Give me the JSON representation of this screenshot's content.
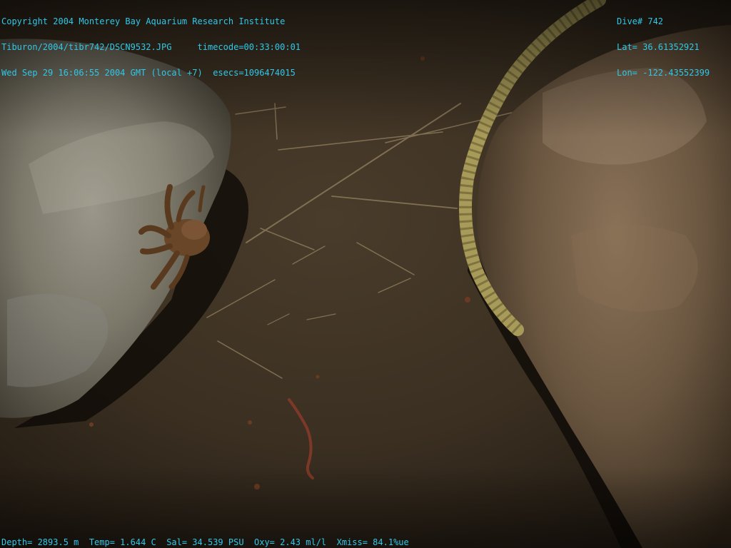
{
  "overlay": {
    "top_left": {
      "line1": "Copyright 2004 Monterey Bay Aquarium Research Institute",
      "line2": "Tiburon/2004/tibr742/DSCN9532.JPG     timecode=00:33:00:01",
      "line3": "Wed Sep 29 16:06:55 2004 GMT (local +7)  esecs=1096474015"
    },
    "top_right": {
      "line1": "Dive# 742",
      "line2": "Lat= 36.61352921",
      "line3": "Lon= -122.43552399"
    },
    "bottom": {
      "line1": "Depth= 2893.5 m  Temp= 1.644 C  Sal= 34.539 PSU  Oxy= 2.43 ml/l  Xmiss= 84.1%ue"
    }
  },
  "colors": {
    "overlay_text": "#30c8e8",
    "sediment": "#3a2e20",
    "left_rock": "#7a7565",
    "right_rock": "#6e5a44",
    "rope": "#a89a5a",
    "crab": "#6a4a2a"
  }
}
